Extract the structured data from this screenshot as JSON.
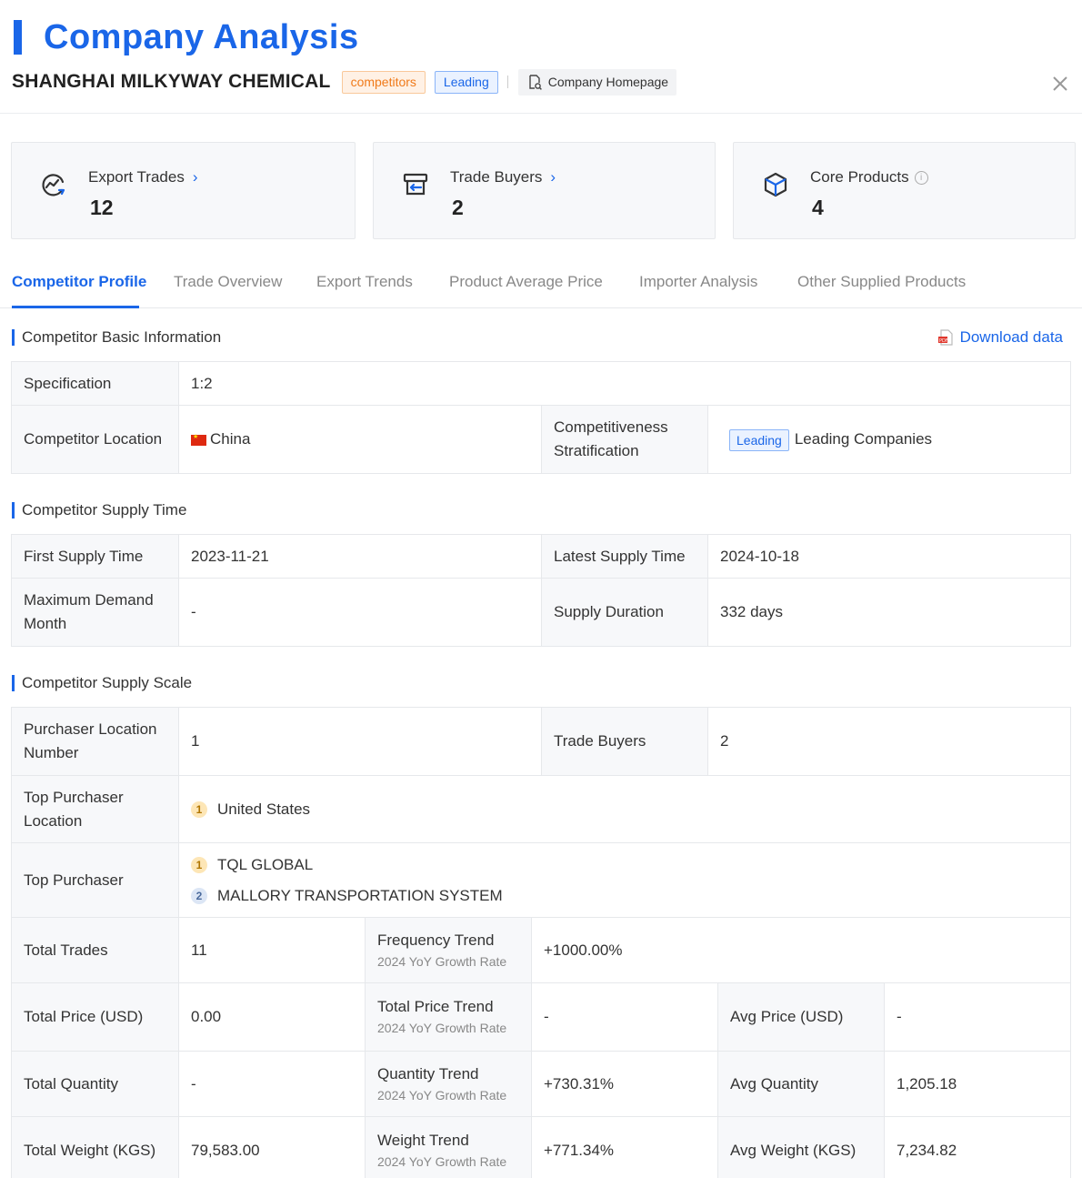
{
  "header": {
    "title": "Company Analysis",
    "company_name": "SHANGHAI MILKYWAY CHEMICAL",
    "tag_competitors": "competitors",
    "tag_leading": "Leading",
    "homepage_label": "Company Homepage"
  },
  "cards": [
    {
      "label": "Export Trades",
      "value": "12",
      "icon": "chart-refresh-icon"
    },
    {
      "label": "Trade Buyers",
      "value": "2",
      "icon": "inbox-arrow-icon"
    },
    {
      "label": "Core Products",
      "value": "4",
      "icon": "cube-icon"
    }
  ],
  "tabs": [
    "Competitor Profile",
    "Trade Overview",
    "Export Trends",
    "Product Average Price",
    "Importer Analysis",
    "Other Supplied Products"
  ],
  "download_label": "Download data",
  "basic": {
    "title": "Competitor Basic Information",
    "spec_label": "Specification",
    "spec_value": "1:2",
    "location_label": "Competitor Location",
    "location_value": "China",
    "strat_label": "Competitiveness Stratification",
    "strat_tag": "Leading",
    "strat_value": "Leading Companies"
  },
  "supply_time": {
    "title": "Competitor Supply Time",
    "first_label": "First Supply Time",
    "first_value": "2023-11-21",
    "latest_label": "Latest Supply Time",
    "latest_value": "2024-10-18",
    "max_label": "Maximum Demand Month",
    "max_value": "-",
    "duration_label": "Supply Duration",
    "duration_value": "332 days"
  },
  "supply_scale": {
    "title": "Competitor Supply Scale",
    "purchaser_loc_label": "Purchaser Location Number",
    "purchaser_loc_value": "1",
    "trade_buyers_label": "Trade Buyers",
    "trade_buyers_value": "2",
    "top_loc_label": "Top Purchaser Location",
    "top_loc_rank": "1",
    "top_loc_value": "United States",
    "top_purchaser_label": "Top Purchaser",
    "top_purchasers": [
      {
        "rank": "1",
        "name": "TQL GLOBAL"
      },
      {
        "rank": "2",
        "name": "MALLORY TRANSPORTATION SYSTEM"
      }
    ],
    "growth_caption": "2024 YoY Growth Rate",
    "total_trades_label": "Total Trades",
    "total_trades_value": "11",
    "freq_trend_label": "Frequency Trend",
    "freq_trend_value": "+1000.00%",
    "total_price_label": "Total Price (USD)",
    "total_price_value": "0.00",
    "price_trend_label": "Total Price Trend",
    "price_trend_value": "-",
    "avg_price_label": "Avg Price (USD)",
    "avg_price_value": "-",
    "total_qty_label": "Total Quantity",
    "total_qty_value": "-",
    "qty_trend_label": "Quantity Trend",
    "qty_trend_value": "+730.31%",
    "avg_qty_label": "Avg Quantity",
    "avg_qty_value": "1,205.18",
    "total_weight_label": "Total Weight (KGS)",
    "total_weight_value": "79,583.00",
    "weight_trend_label": "Weight Trend",
    "weight_trend_value": "+771.34%",
    "avg_weight_label": "Avg Weight (KGS)",
    "avg_weight_value": "7,234.82"
  },
  "colors": {
    "accent": "#1a66e8",
    "red": "#e0362c",
    "orange": "#f07a1a"
  }
}
